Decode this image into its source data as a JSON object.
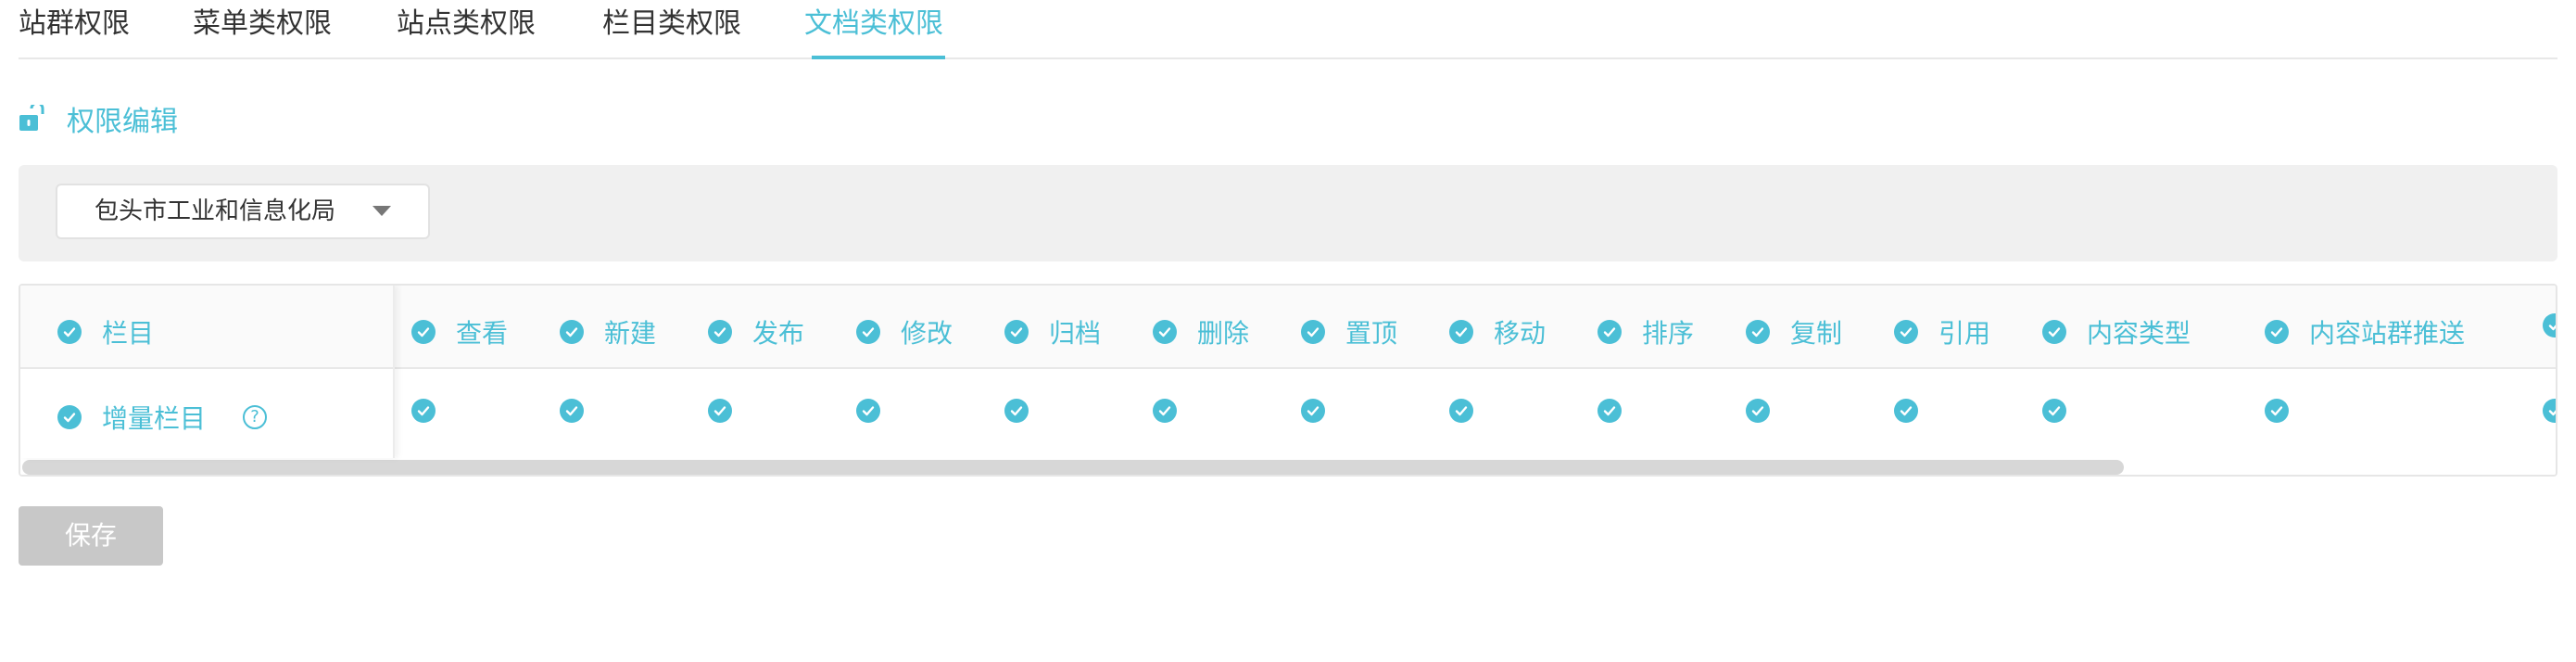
{
  "tabs": [
    {
      "label": "站群权限"
    },
    {
      "label": "菜单类权限"
    },
    {
      "label": "站点类权限"
    },
    {
      "label": "栏目类权限"
    },
    {
      "label": "文档类权限"
    }
  ],
  "active_tab": "文档类权限",
  "section": {
    "title": "权限编辑",
    "icon": "unlock-icon"
  },
  "filter": {
    "selected": "包头市工业和信息化局"
  },
  "table": {
    "fixed_header": "栏目",
    "columns": [
      "查看",
      "新建",
      "发布",
      "修改",
      "归档",
      "删除",
      "置顶",
      "移动",
      "排序",
      "复制",
      "引用",
      "内容类型",
      "内容站群推送"
    ],
    "rows": [
      {
        "name": "增量栏目",
        "help": "?"
      }
    ]
  },
  "save_label": "保存",
  "colors": {
    "accent": "#4bbfd6",
    "disabled_button": "#c8c8c8",
    "filter_bg": "#f0f0f0"
  }
}
